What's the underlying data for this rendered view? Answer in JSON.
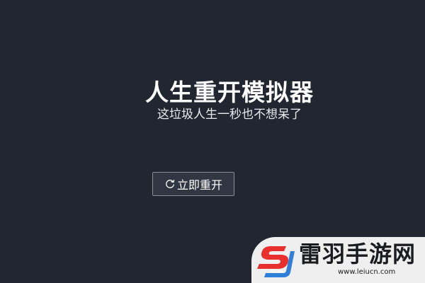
{
  "main": {
    "title": "人生重开模拟器",
    "subtitle": "这垃圾人生一秒也不想呆了",
    "restart_button": {
      "label": "立即重开",
      "icon": "refresh-icon"
    }
  },
  "watermark": {
    "name": "雷羽手游网",
    "url": "www.leiucn.com",
    "logo_icon": "brand-logo-icon"
  },
  "colors": {
    "background": "#222631",
    "button_border": "#8a8f99",
    "logo_red": "#e8312f",
    "logo_blue": "#2f7fd8"
  }
}
